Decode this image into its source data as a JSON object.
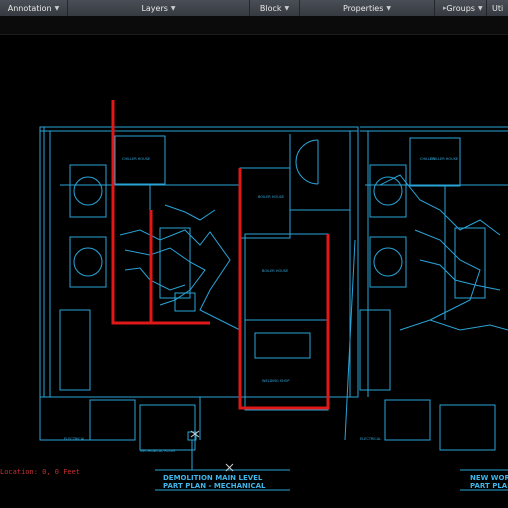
{
  "ribbon": {
    "panels": [
      {
        "label": "Annotation"
      },
      {
        "label": "Layers"
      },
      {
        "label": "Block"
      },
      {
        "label": "Properties"
      },
      {
        "label": "Groups"
      },
      {
        "label": "Uti"
      }
    ]
  },
  "drawing": {
    "left_title_line1": "DEMOLITION MAIN LEVEL",
    "left_title_line2": "PART PLAN - MECHANICAL",
    "right_title_line1": "NEW WORK M",
    "right_title_line2": "PART PLAN -",
    "room_labels": [
      "CHILLER HOUSE",
      "BOILER HOUSE",
      "BOILER HOUSE",
      "WELDING SHOP",
      "CHILLER",
      "CHILLER HOUSE",
      "ELECTRICAL",
      "ELECTRICAL",
      "MECHANICAL ROOM"
    ]
  },
  "status": {
    "coordinate_readout": "Location: 0, 0 Feet"
  },
  "colors": {
    "linework": "#2aa4d8",
    "markup": "#e01818",
    "ribbon_bg": "#3d424a",
    "canvas_bg": "#000000"
  }
}
